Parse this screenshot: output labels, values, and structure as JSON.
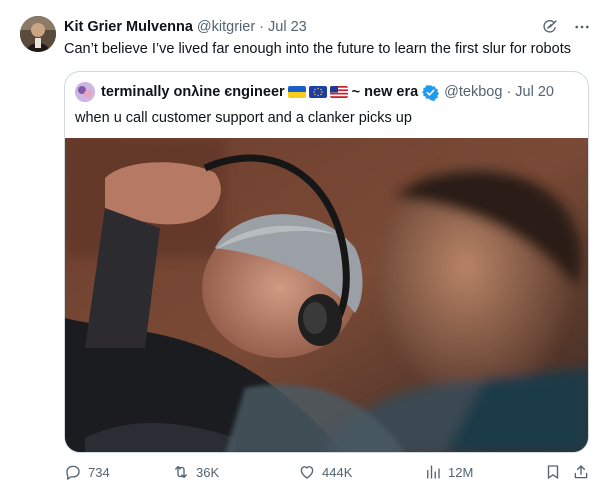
{
  "tweet": {
    "author": {
      "display_name": "Kit Grier Mulvenna",
      "handle": "@kitgrier",
      "separator": "·",
      "date": "Jul 23"
    },
    "text": "Can’t believe I’ve lived far enough into the future to learn the first slur for robots",
    "icons": [
      "grok-icon",
      "more-icon"
    ]
  },
  "quote": {
    "author": {
      "display_name": "terminally onλine єngineer",
      "flags": [
        "ukraine-flag",
        "eu-flag",
        "us-flag"
      ],
      "name_tail": "~ new era",
      "verified": true,
      "handle": "@tekbog",
      "separator": "·",
      "date": "Jul 20"
    },
    "text": "when u call customer support and a clanker picks up",
    "media": "photo"
  },
  "actions": {
    "replies": "734",
    "reposts": "36K",
    "likes": "444K",
    "views": "12M"
  },
  "colors": {
    "text_primary": "#0f1419",
    "text_secondary": "#536471",
    "border": "#cfd9de",
    "verified_blue": "#1d9bf0"
  }
}
